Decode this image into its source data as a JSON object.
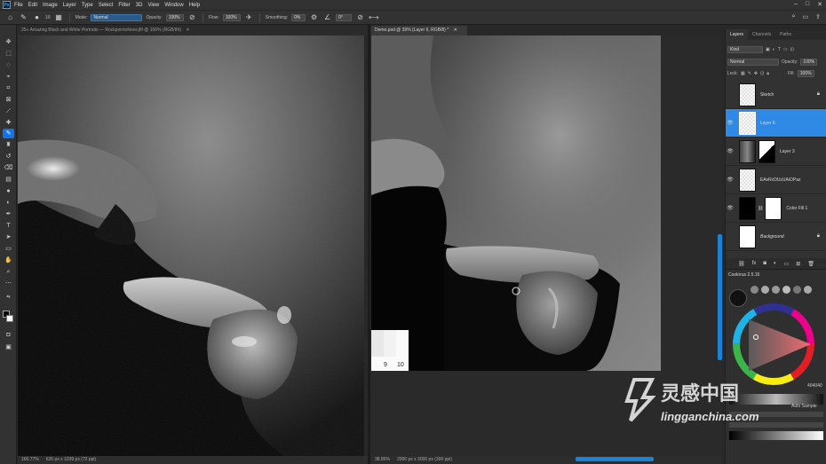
{
  "app": {
    "logo": "Ps"
  },
  "menu": [
    "File",
    "Edit",
    "Image",
    "Layer",
    "Type",
    "Select",
    "Filter",
    "3D",
    "View",
    "Window",
    "Help"
  ],
  "options_bar": {
    "brush_size": "10",
    "mode_label": "Mode:",
    "mode_value": "Normal",
    "opacity_label": "Opacity:",
    "opacity_value": "100%",
    "flow_label": "Flow:",
    "flow_value": "100%",
    "smoothing_label": "Smoothing:",
    "smoothing_value": "0%",
    "angle_value": "0°"
  },
  "documents": {
    "left": {
      "tab_title": "25+ Amazing Black and White Portraits — Rockpointofview.jfif @ 166% (RGB/8#)",
      "zoom": "166.77%",
      "info": "626 px x 1039 px (72 ppi)"
    },
    "right": {
      "tab_title": "Demo.psd @ 39% (Layer 6, RGB/8) *",
      "zoom": "38.86%",
      "info": "2000 px x 3000 px (300 ppi)",
      "palette_numbers": [
        "9",
        "10"
      ]
    }
  },
  "layers_panel": {
    "tabs": [
      "Layers",
      "Channels",
      "Paths"
    ],
    "filter_kind": "Kind",
    "blend_mode": "Normal",
    "opacity_label": "Opacity:",
    "opacity_value": "100%",
    "lock_label": "Lock:",
    "fill_label": "Fill:",
    "fill_value": "100%",
    "layers": [
      {
        "name": "Sketch",
        "visible": false,
        "locked": true,
        "selected": false
      },
      {
        "name": "Layer 6",
        "visible": true,
        "locked": false,
        "selected": true
      },
      {
        "name": "Layer 3",
        "visible": true,
        "locked": false,
        "selected": false
      },
      {
        "name": "EAvRcDUzUAiOPaz",
        "visible": true,
        "locked": false,
        "selected": false
      },
      {
        "name": "Color Fill 1",
        "visible": true,
        "locked": false,
        "selected": false
      },
      {
        "name": "Background",
        "visible": false,
        "locked": true,
        "selected": false
      }
    ]
  },
  "coolorus": {
    "title": "Coolorus 2.5.16",
    "hex": "404040",
    "auto_sample": "Auto Sample"
  },
  "watermark": {
    "cn": "灵感中国",
    "url": "lingganchina.com"
  },
  "colors": {
    "accent": "#1473e6",
    "selected_layer": "#2f8ae5",
    "panel_bg": "#323232"
  }
}
